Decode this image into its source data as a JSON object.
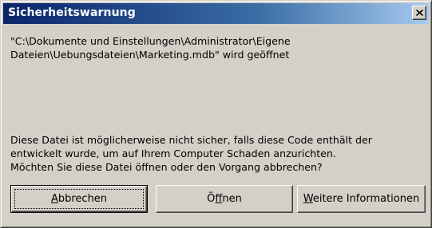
{
  "window": {
    "title": "Sicherheitswarnung",
    "close_label": "×"
  },
  "message": {
    "path_line1": "\"C:\\Dokumente und Einstellungen\\Administrator\\Eigene",
    "path_line2": "Dateien\\Uebungsdateien\\Marketing.mdb\" wird geöffnet",
    "warning_line1": "Diese Datei ist möglicherweise nicht sicher, falls diese Code enthält der",
    "warning_line2": "entwickelt wurde, um auf Ihrem Computer Schaden anzurichten.",
    "warning_line3": "Möchten Sie diese Datei öffnen oder den Vorgang abbrechen?"
  },
  "buttons": {
    "cancel": {
      "label": "Abbrechen",
      "mnemonic": "A",
      "rest": "bbrechen"
    },
    "open": {
      "label": "Öffnen",
      "before": "Ö",
      "mnemonic": "f",
      "rest": "fnen"
    },
    "more_info": {
      "label": "Weitere Informationen",
      "mnemonic": "W",
      "rest": "eitere Informationen"
    }
  },
  "colors": {
    "titlebar_start": "#0a246a",
    "titlebar_end": "#a6caf0",
    "face": "#d4d0c8"
  },
  "icons": {
    "close": "close-icon"
  }
}
